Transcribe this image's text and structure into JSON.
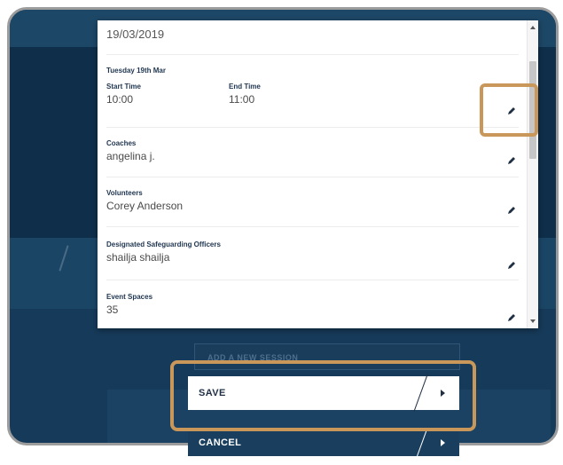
{
  "session": {
    "date": "19/03/2019",
    "day_label": "Tuesday 19th Mar",
    "start_time_label": "Start Time",
    "start_time": "10:00",
    "end_time_label": "End Time",
    "end_time": "11:00"
  },
  "fields": [
    {
      "label": "Coaches",
      "value": "angelina j."
    },
    {
      "label": "Volunteers",
      "value": "Corey Anderson"
    },
    {
      "label": "Designated Safeguarding Officers",
      "value": "shailja shailja"
    },
    {
      "label": "Event Spaces",
      "value": "35"
    }
  ],
  "buttons": {
    "save": "SAVE",
    "cancel": "CANCEL"
  },
  "background": {
    "add_session": "ADD A NEW SESSION"
  },
  "colors": {
    "highlight": "#c9975a",
    "dark_bg": "#0f2e4a",
    "button_text": "#1f2f44"
  },
  "icons": [
    "pencil-icon",
    "chevron-right-icon",
    "scroll-up-icon",
    "scroll-down-icon"
  ]
}
